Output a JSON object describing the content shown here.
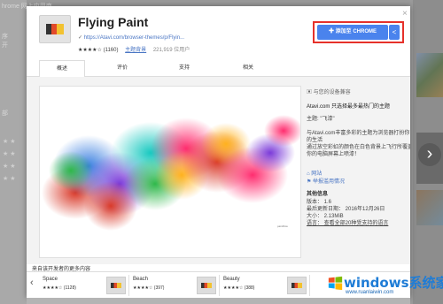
{
  "background": {
    "left_texts": [
      "hrome 网上应用商",
      "序",
      "开",
      "部"
    ],
    "right_arrow": "›"
  },
  "dialog": {
    "title": "Flying Paint",
    "site": "https://Atavi.com/browser-themes/p/Flyin...",
    "stars": "★★★★☆",
    "rating_count": "(1160)",
    "category": "主题背景",
    "users": "221,919 位用户",
    "add_button": "添加至 CHROME",
    "close": "×"
  },
  "tabs": [
    "概述",
    "评价",
    "支持",
    "相关"
  ],
  "screenshot": {
    "caption": "paintflow"
  },
  "sidebar": {
    "compat": "与您的设备兼容",
    "headline": "Atavi.com 只选择最多最热门的主题",
    "theme_name": "主题: \"飞漆\"",
    "desc1": "与Atavi.com丰富多彩的主题为浏览器打扮你",
    "desc2": "的生活",
    "desc3": "通过放空彩虹的颜色在白色背景上飞行所覆盖",
    "desc4": "你的电脑屏幕上喷漆！",
    "site_link": "网站",
    "report_link": "举报滥用情况",
    "extra_info": "其他信息",
    "version": "版本：  1.6",
    "updated": "最后更新日期：  2016年12月26日",
    "size": "大小：  2.13MiB",
    "language": "语言：  查看全部20种受支持的语言"
  },
  "more": {
    "title": "来自该开发者的更多内容",
    "prev": "‹",
    "cards": [
      {
        "name": "Space",
        "rating": "★★★★☆ (1128)"
      },
      {
        "name": "Beach",
        "rating": "★★★★☆ (397)"
      },
      {
        "name": "Beauty",
        "rating": "★★★★☆ (388)"
      }
    ]
  },
  "watermark": {
    "text": "windows系统家园",
    "sub": "www.ruanlaiwin.com"
  },
  "colors": {
    "accent": "#4a83ed",
    "highlight": "#e6312a",
    "link": "#4a76c4"
  }
}
